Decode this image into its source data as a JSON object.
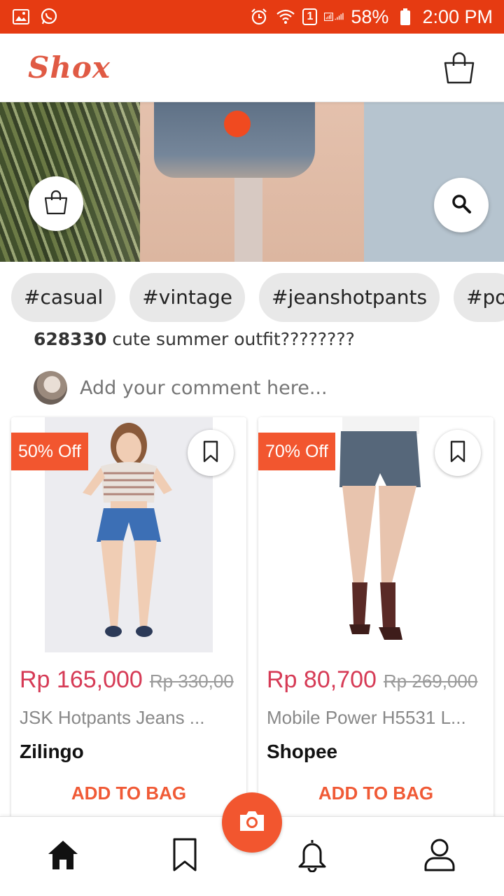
{
  "status_bar": {
    "battery": "58%",
    "time": "2:00 PM",
    "sim_badge": "1",
    "icons": [
      "image-icon",
      "whatsapp-icon",
      "alarm-icon",
      "wifi-icon",
      "signal-icon",
      "battery-icon"
    ]
  },
  "app_bar": {
    "logo": "Shox",
    "cart_icon": "shopping-bag-icon"
  },
  "hero": {
    "bag_icon": "shopping-bag-icon",
    "search_icon": "search-icon"
  },
  "tags": [
    "#casual",
    "#vintage",
    "#jeanshotpants",
    "#po"
  ],
  "post": {
    "likes": "628330",
    "caption": " cute summer outfit????????",
    "comment_placeholder": "Add your comment here..."
  },
  "products": [
    {
      "discount": "50% Off",
      "price": "Rp 165,000",
      "old_price": "Rp 330,00",
      "name": "JSK Hotpants Jeans ...",
      "store": "Zilingo",
      "action": "ADD TO BAG"
    },
    {
      "discount": "70% Off",
      "price": "Rp 80,700",
      "old_price": "Rp 269,000",
      "name": "Mobile Power H5531 L...",
      "store": "Shopee",
      "action": "ADD TO BAG"
    }
  ],
  "bottom_nav": {
    "items": [
      "home-icon",
      "bookmark-icon",
      "bell-icon",
      "profile-icon"
    ],
    "center": "camera-icon"
  },
  "colors": {
    "status_bar": "#e63b12",
    "accent": "#f2562f",
    "price": "#d63a55",
    "logo": "#e05a44"
  }
}
